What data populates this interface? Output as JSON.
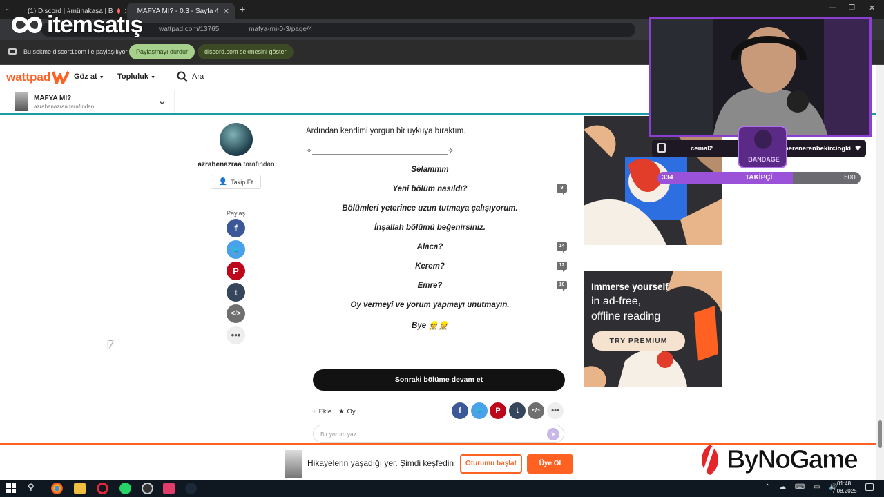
{
  "browser": {
    "tabs": [
      {
        "title": "(1) Discord | #münakaşa | B"
      },
      {
        "title": "MAFYA MI? - 0.3 - Sayfa 4"
      }
    ],
    "url_visible_1": "wattpad.com/13765",
    "url_visible_2": "mafya-mi-0-3/page/4",
    "share_text": "Bu sekme discord.com ile paylaşılıyor",
    "stop_sharing": "Paylaşmayı durdur",
    "show_tab": "discord.com sekmesini göster"
  },
  "overlay": {
    "logo_text": "itemsatış",
    "bynogame": "ByNoGame",
    "follower_label": "TAKİPÇİ",
    "follower_current": "334",
    "follower_goal": "500",
    "follower_progress": 0.668,
    "left_user": "cemal2",
    "right_user": "alperenerenbekirciogki",
    "badge_text": "BANDAGE"
  },
  "wattpad": {
    "logo": "wattpad",
    "browse": "Göz at",
    "community": "Topluluk",
    "search": "Ara",
    "story_title": "MAFYA MI?",
    "story_author": "azrabenazraa tarafından",
    "author_name": "azrabenazraa",
    "author_suffix": "tarafından",
    "follow": "Takip Et",
    "share_label": "Paylaş",
    "lines": [
      "Ardından kendimi yorgun bir uykuya bıraktım.",
      "✧________________________________✧",
      "Selammm",
      "Yeni bölüm nasıldı?",
      "Bölümleri yeterince uzun tutmaya çalışıyorum.",
      "İnşallah bölümü beğenirsiniz.",
      "Alaca?",
      "Kerem?",
      "Emre?",
      "Oy vermeyi ve yorum yapmayı unutmayın.",
      "Bye 👷👷"
    ],
    "comment_counts": {
      "yeni": "9",
      "alaca": "14",
      "kerem": "12",
      "emre": "10"
    },
    "next_chapter": "Sonraki bölüme devam et",
    "add": "Ekle",
    "vote": "Oy",
    "comment_placeholder": "Bir yorum yaz...",
    "ad": {
      "line1": "Immerse yourself",
      "line2": "in ad-free,",
      "line3": "offline reading",
      "cta": "TRY PREMIUM"
    },
    "bottom_text": "Hikayelerin yaşadığı yer. Şimdi keşfedin",
    "start_reading": "Oturumu başlat",
    "signup": "Üye Ol"
  },
  "taskbar": {
    "time": "01:48",
    "date": "7.08.2025"
  },
  "colors": {
    "wattpad_orange": "#ff6122",
    "teal": "#1d9ba5",
    "dark_button": "#121212"
  }
}
